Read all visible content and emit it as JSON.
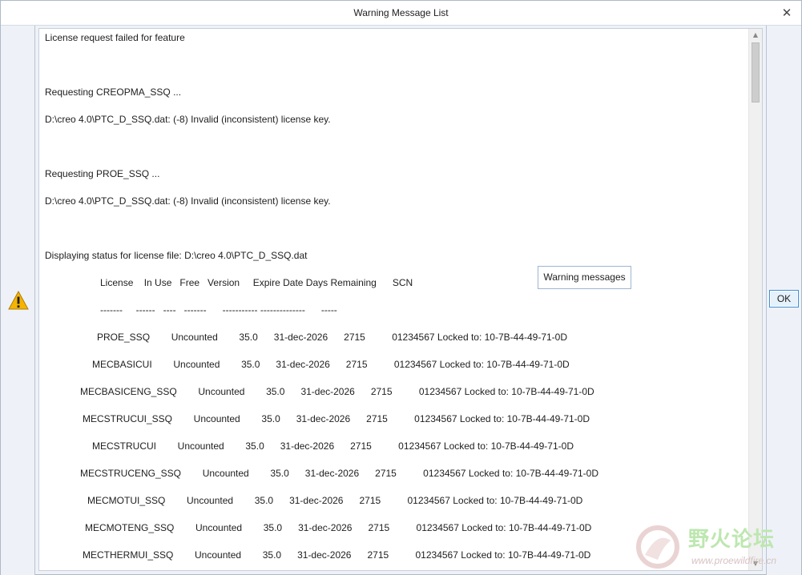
{
  "window": {
    "title": "Warning Message List",
    "close_glyph": "✕"
  },
  "ok_button": {
    "label": "OK"
  },
  "tooltip": {
    "text": "Warning messages"
  },
  "messages": [
    "License request failed for feature",
    "Requesting CREOPMA_SSQ ...",
    "D:\\creo 4.0\\PTC_D_SSQ.dat: (-8) Invalid (inconsistent) license key.",
    "Requesting PROE_SSQ ...",
    "D:\\creo 4.0\\PTC_D_SSQ.dat: (-8) Invalid (inconsistent) license key.",
    "Displaying status for license file: D:\\creo 4.0\\PTC_D_SSQ.dat",
    "License    In Use   Free   Version     Expire Date Days Remaining      SCN",
    "-------     ------   ----   -------      ----------- --------------      -----",
    "PROE_SSQ        Uncounted        35.0      31-dec-2026      2715          01234567 Locked to: 10-7B-44-49-71-0D",
    "MECBASICUI        Uncounted        35.0      31-dec-2026      2715          01234567 Locked to: 10-7B-44-49-71-0D",
    "MECBASICENG_SSQ        Uncounted        35.0      31-dec-2026      2715          01234567 Locked to: 10-7B-44-49-71-0D",
    "MECSTRUCUI_SSQ        Uncounted        35.0      31-dec-2026      2715          01234567 Locked to: 10-7B-44-49-71-0D",
    "MECSTRUCUI        Uncounted        35.0      31-dec-2026      2715          01234567 Locked to: 10-7B-44-49-71-0D",
    "MECSTRUCENG_SSQ        Uncounted        35.0      31-dec-2026      2715          01234567 Locked to: 10-7B-44-49-71-0D",
    "MECMOTUI_SSQ        Uncounted        35.0      31-dec-2026      2715          01234567 Locked to: 10-7B-44-49-71-0D",
    "MECMOTENG_SSQ        Uncounted        35.0      31-dec-2026      2715          01234567 Locked to: 10-7B-44-49-71-0D",
    "MECTHERMUI_SSQ        Uncounted        35.0      31-dec-2026      2715          01234567 Locked to: 10-7B-44-49-71-0D"
  ],
  "scrollbar": {
    "up_glyph": "▲",
    "down_glyph": "▼"
  },
  "icons": {
    "warning": "warning-icon",
    "close": "close-icon"
  },
  "colors": {
    "warning_fill": "#f5b400",
    "ok_border": "#3f8fd6",
    "accent_bg": "#e5f1fb"
  },
  "watermark": {
    "logo_text": "野火论坛",
    "url": "www.proewildfire.cn"
  }
}
